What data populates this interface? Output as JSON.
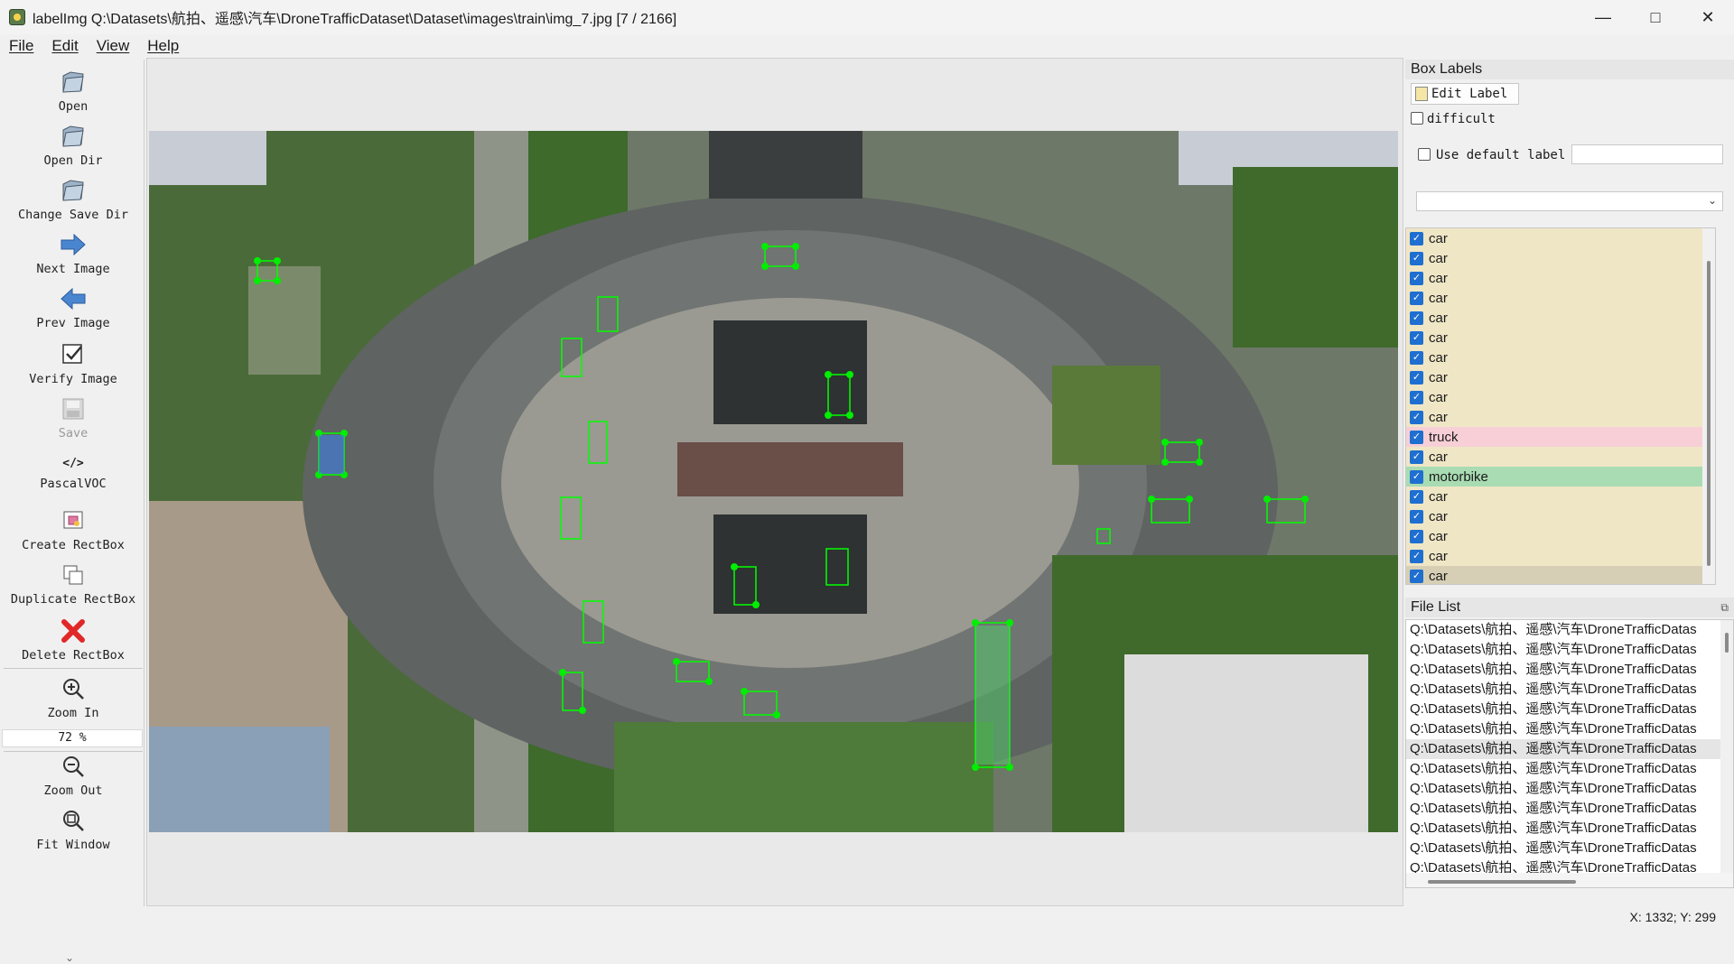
{
  "window": {
    "title": "labelImg Q:\\Datasets\\航拍、遥感\\汽车\\DroneTrafficDataset\\Dataset\\images\\train\\img_7.jpg [7 / 2166]",
    "minimize_icon": "minimize-icon",
    "maximize_icon": "maximize-icon",
    "close_icon": "close-icon"
  },
  "menu": [
    "File",
    "Edit",
    "View",
    "Help"
  ],
  "toolbar": {
    "open": "Open",
    "open_dir": "Open Dir",
    "change_save_dir": "Change Save Dir",
    "next_image": "Next Image",
    "prev_image": "Prev Image",
    "verify_image": "Verify Image",
    "save": "Save",
    "format": "PascalVOC",
    "create_rectbox": "Create RectBox",
    "duplicate_rectbox": "Duplicate RectBox",
    "delete_rectbox": "Delete RectBox",
    "zoom_in": "Zoom In",
    "zoom_level": "72 %",
    "zoom_out": "Zoom Out",
    "fit_window": "Fit Window"
  },
  "box_labels": {
    "title": "Box Labels",
    "edit_label": "Edit Label",
    "difficult": "difficult",
    "use_default_label": "Use default label",
    "default_label_value": "",
    "combo_value": "",
    "items": [
      {
        "label": "car",
        "color": "#efe6c6"
      },
      {
        "label": "car",
        "color": "#efe6c6"
      },
      {
        "label": "car",
        "color": "#efe6c6"
      },
      {
        "label": "car",
        "color": "#efe6c6"
      },
      {
        "label": "car",
        "color": "#efe6c6"
      },
      {
        "label": "car",
        "color": "#efe6c6"
      },
      {
        "label": "car",
        "color": "#efe6c6"
      },
      {
        "label": "car",
        "color": "#efe6c6"
      },
      {
        "label": "car",
        "color": "#efe6c6"
      },
      {
        "label": "car",
        "color": "#efe6c6"
      },
      {
        "label": "truck",
        "color": "#f8cfd6"
      },
      {
        "label": "car",
        "color": "#efe6c6"
      },
      {
        "label": "motorbike",
        "color": "#a9dcb3"
      },
      {
        "label": "car",
        "color": "#efe6c6"
      },
      {
        "label": "car",
        "color": "#efe6c6"
      },
      {
        "label": "car",
        "color": "#efe6c6"
      },
      {
        "label": "car",
        "color": "#efe6c6"
      },
      {
        "label": "car",
        "color": "#d6cfb6"
      }
    ]
  },
  "file_list": {
    "title": "File List",
    "items": [
      "Q:\\Datasets\\航拍、遥感\\汽车\\DroneTrafficDatas",
      "Q:\\Datasets\\航拍、遥感\\汽车\\DroneTrafficDatas",
      "Q:\\Datasets\\航拍、遥感\\汽车\\DroneTrafficDatas",
      "Q:\\Datasets\\航拍、遥感\\汽车\\DroneTrafficDatas",
      "Q:\\Datasets\\航拍、遥感\\汽车\\DroneTrafficDatas",
      "Q:\\Datasets\\航拍、遥感\\汽车\\DroneTrafficDatas",
      "Q:\\Datasets\\航拍、遥感\\汽车\\DroneTrafficDatas",
      "Q:\\Datasets\\航拍、遥感\\汽车\\DroneTrafficDatas",
      "Q:\\Datasets\\航拍、遥感\\汽车\\DroneTrafficDatas",
      "Q:\\Datasets\\航拍、遥感\\汽车\\DroneTrafficDatas",
      "Q:\\Datasets\\航拍、遥感\\汽车\\DroneTrafficDatas",
      "Q:\\Datasets\\航拍、遥感\\汽车\\DroneTrafficDatas",
      "Q:\\Datasets\\航拍、遥感\\汽车\\DroneTrafficDatas"
    ],
    "selected_index": 6
  },
  "status": {
    "coords": "X: 1332; Y: 299"
  }
}
